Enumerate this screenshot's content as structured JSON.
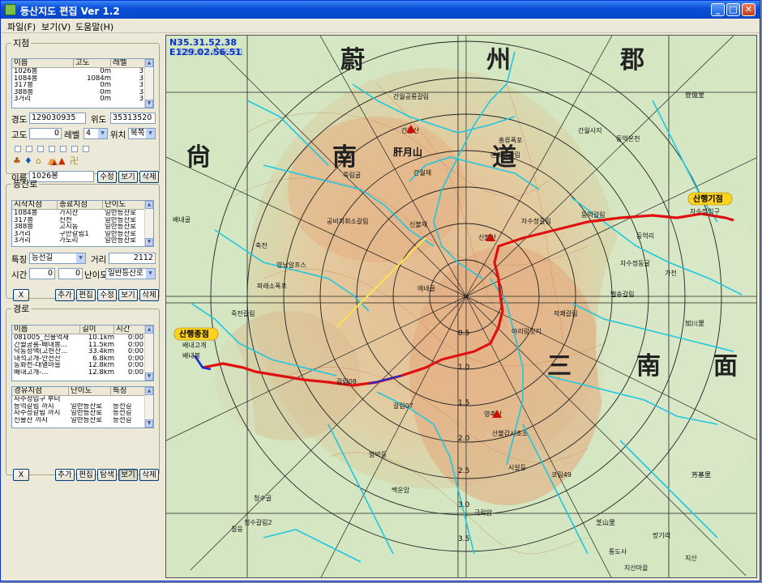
{
  "window": {
    "title": "등산지도 편집 Ver 1.2",
    "min": "_",
    "max": "□",
    "close": "✕"
  },
  "menu": [
    {
      "label": "파일(F)"
    },
    {
      "label": "보기(V)"
    },
    {
      "label": "도움말(H)"
    }
  ],
  "left": {
    "jijeom": {
      "legend": "지점",
      "columns": [
        "이름",
        "고도",
        "레벨"
      ],
      "rows": [
        [
          "1026봉",
          "0m",
          "3"
        ],
        [
          "1084봉",
          "1084m",
          "3"
        ],
        [
          "317봉",
          "0m",
          "3"
        ],
        [
          "388봉",
          "0m",
          "3"
        ],
        [
          "3거리",
          "0m",
          "3"
        ]
      ],
      "lon_label": "경도",
      "lon": "129030935",
      "lat_label": "위도",
      "lat": "35313520",
      "alt_label": "고도",
      "alt": "0",
      "level_label": "레벨",
      "level": "4",
      "pos_label": "위치",
      "pos": "북쪽",
      "name_label": "이름",
      "name": "1026봉",
      "edit_btn": "수정",
      "view_btn": "보기",
      "del_btn": "삭제"
    },
    "trail": {
      "legend": "등산로",
      "columns": [
        "시작지점",
        "종료지점",
        "난이도"
      ],
      "rows": [
        [
          "1084봉",
          "가지산",
          "일반등산로"
        ],
        [
          "317봉",
          "신천",
          "일반등산로"
        ],
        [
          "388봉",
          "고지동",
          "일반등산로"
        ],
        [
          "3거리",
          "구만갈림1",
          "일반등산로"
        ],
        [
          "3거리",
          "가도리",
          "일반등산로"
        ]
      ],
      "feature_label": "특징",
      "feature": "능선길",
      "dist_label": "거리",
      "dist": "2112",
      "time_label": "시간",
      "time_h": "0",
      "time_m": "0",
      "diff_label": "난이도",
      "diff": "일반등산로",
      "x_btn": "X",
      "add_btn": "추가",
      "edit_btn": "편집",
      "mod_btn": "수정",
      "view_btn": "보기",
      "del_btn": "삭제"
    },
    "route": {
      "legend": "경로",
      "columns": [
        "이름",
        "길이",
        "시간"
      ],
      "rows": [
        [
          "081005_신불억새",
          "10.1km",
          "0:00"
        ],
        [
          "간월공룡-배내봉...",
          "11.5km",
          "0:00"
        ],
        [
          "낙동정맥(고헌산...",
          "33.4km",
          "0:00"
        ],
        [
          "내석고개-안전산",
          "6.8km",
          "0:00"
        ],
        [
          "동화천-대열마을",
          "12.8km",
          "0:00"
        ],
        [
          "배내고개-...",
          "12.8km",
          "0:00"
        ]
      ],
      "via_columns": [
        "경유지점",
        "난이도",
        "특징"
      ],
      "via_rows": [
        [
          "자수정입구 부터",
          "",
          ""
        ],
        [
          "등억갈림 까지",
          "일반등산로",
          "능선길"
        ],
        [
          "자수정갈림 까지",
          "일반등산로",
          "능선길"
        ],
        [
          "신불산 까지",
          "일반등산로",
          "능선길"
        ]
      ],
      "x_btn": "X",
      "add_btn": "추가",
      "edit_btn": "편집",
      "search_btn": "탐색",
      "view_btn": "보기",
      "del_btn": "삭제"
    }
  },
  "map": {
    "coord_n": "N35.31.52.38",
    "coord_e": "E129.02.56.51",
    "coord_e_ghost": "E120.34.06.61",
    "big_labels": [
      "蔚",
      "州",
      "郡",
      "尙",
      "南",
      "道",
      "三",
      "南",
      "面"
    ],
    "start_label": "산행기점",
    "end_label": "산행종점",
    "dist_labels": [
      "0.5",
      "1.0",
      "1.5",
      "2.0",
      "2.5",
      "3.0",
      "3.5"
    ],
    "place_labels": [
      "간월공룡갈림",
      "간월재",
      "신불산",
      "영축산",
      "자수정갈림",
      "등억갈림",
      "자수정입구",
      "간월산",
      "배내고개",
      "배내봉",
      "죽전갈림",
      "홍류폭포",
      "단조늪갈림",
      "죽림굴",
      "파래소폭포",
      "신불재",
      "영남알프스",
      "가천",
      "작쾌갈림",
      "갈림08",
      "갈림07",
      "산불감시초소",
      "지산",
      "청수골",
      "백운암",
      "통도사",
      "극락암",
      "방기리",
      "축전",
      "등억리",
      "동억온천",
      "벌송갈림",
      "공비지휘소갈림",
      "에네골",
      "자수정동굴",
      "아리랑릿지",
      "시살등",
      "배내골",
      "함박등",
      "청수갈림2",
      "코림49",
      "지산마을",
      "간월사지",
      "칠웅",
      "登億里",
      "加川里",
      "芳基里",
      "芝山里",
      "肝月山"
    ]
  }
}
